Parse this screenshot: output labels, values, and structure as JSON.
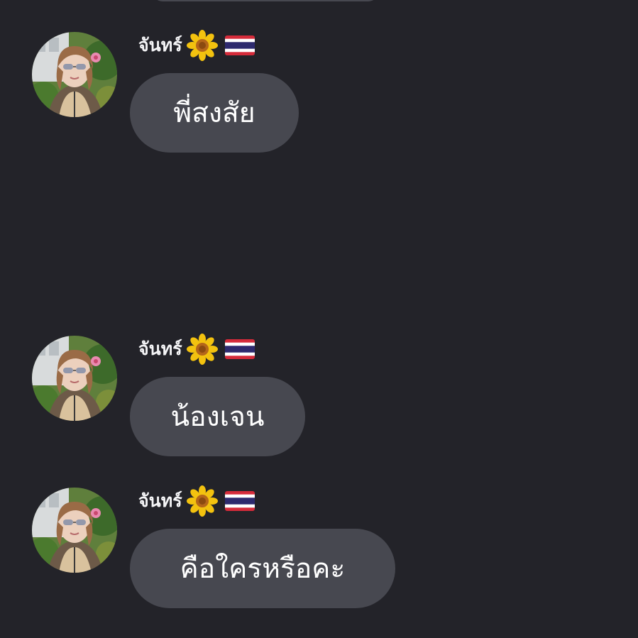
{
  "messages": [
    {
      "sender": "จันทร์",
      "text": "พี่สงสัย"
    },
    {
      "sender": "จันทร์",
      "text": "น้องเจน"
    },
    {
      "sender": "จันทร์",
      "text": "คือใครหรือคะ"
    }
  ],
  "colors": {
    "background": "#232329",
    "bubble": "#474850",
    "text": "#ffffff"
  },
  "icons": {
    "sender_emoji": "sunflower-icon",
    "sender_flag": "thailand-flag-icon"
  }
}
